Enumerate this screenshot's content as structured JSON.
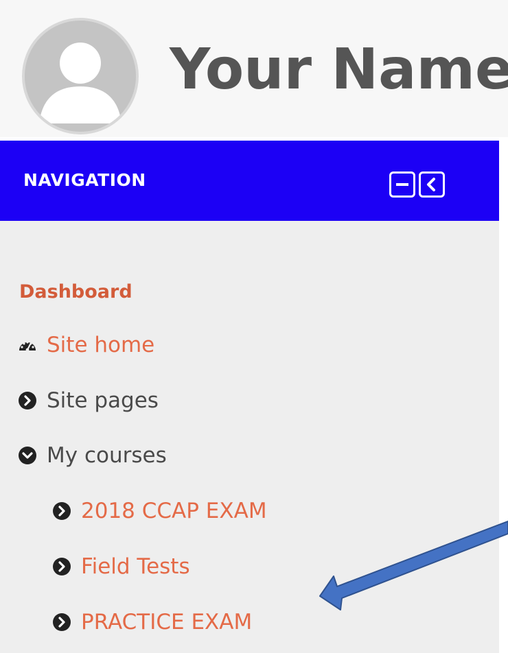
{
  "profile": {
    "name": "Your Name"
  },
  "navigation": {
    "title": "NAVIGATION",
    "controls": [
      {
        "icon": "minus-icon"
      },
      {
        "icon": "chevron-left-icon"
      }
    ],
    "items": [
      {
        "label": "Dashboard",
        "style": "bold-link",
        "icon": "none"
      },
      {
        "label": "Site home",
        "style": "link",
        "icon": "dashboard-icon"
      },
      {
        "label": "Site pages",
        "style": "plain",
        "icon": "chevron-right-circle-icon"
      },
      {
        "label": "My courses",
        "style": "plain",
        "icon": "chevron-down-circle-icon"
      },
      {
        "label": "2018 CCAP EXAM",
        "style": "link",
        "icon": "chevron-right-circle-icon"
      },
      {
        "label": "Field Tests",
        "style": "link",
        "icon": "chevron-right-circle-icon"
      },
      {
        "label": "PRACTICE EXAM",
        "style": "link",
        "icon": "chevron-right-circle-icon"
      }
    ]
  },
  "colors": {
    "nav_header_bg": "#1c00f5",
    "link": "#e46a47",
    "text": "#4a4a4a",
    "annotation_arrow": "#4472c4"
  }
}
